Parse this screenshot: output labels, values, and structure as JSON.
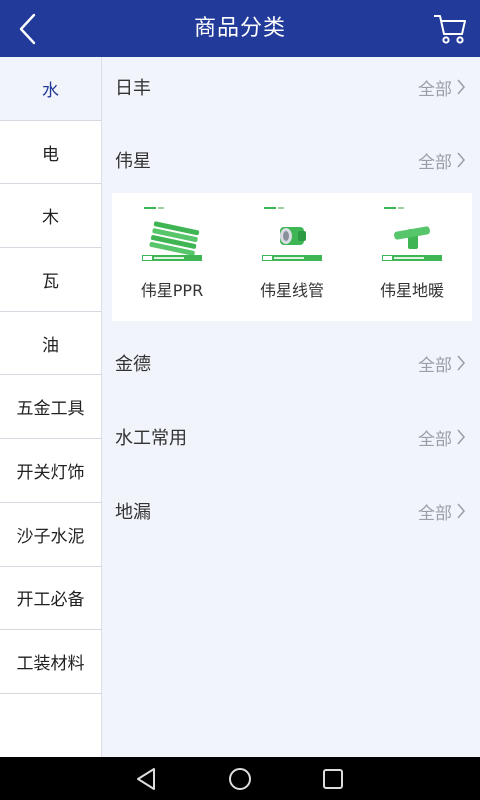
{
  "header": {
    "title": "商品分类",
    "back_icon": "back-chevron-icon",
    "cart_icon": "cart-icon"
  },
  "sidebar": {
    "items": [
      {
        "label": "水",
        "active": true
      },
      {
        "label": "电"
      },
      {
        "label": "木"
      },
      {
        "label": "瓦"
      },
      {
        "label": "油"
      },
      {
        "label": "五金工具"
      },
      {
        "label": "开关灯饰"
      },
      {
        "label": "沙子水泥"
      },
      {
        "label": "开工必备"
      },
      {
        "label": "工装材料"
      }
    ]
  },
  "main": {
    "more_label": "全部",
    "brands": [
      {
        "name": "日丰"
      },
      {
        "name": "伟星"
      },
      {
        "name": "金德"
      },
      {
        "name": "水工常用"
      },
      {
        "name": "地漏"
      }
    ],
    "products": [
      {
        "name": "伟星PPR"
      },
      {
        "name": "伟星线管"
      },
      {
        "name": "伟星地暖"
      }
    ]
  },
  "navbar": {
    "back_icon": "triangle-back-icon",
    "home_icon": "circle-home-icon",
    "recents_icon": "square-recents-icon"
  },
  "colors": {
    "header": "#223a99",
    "background": "#f1f4fb",
    "accent": "#223a99",
    "product_green": "#3fb554"
  }
}
